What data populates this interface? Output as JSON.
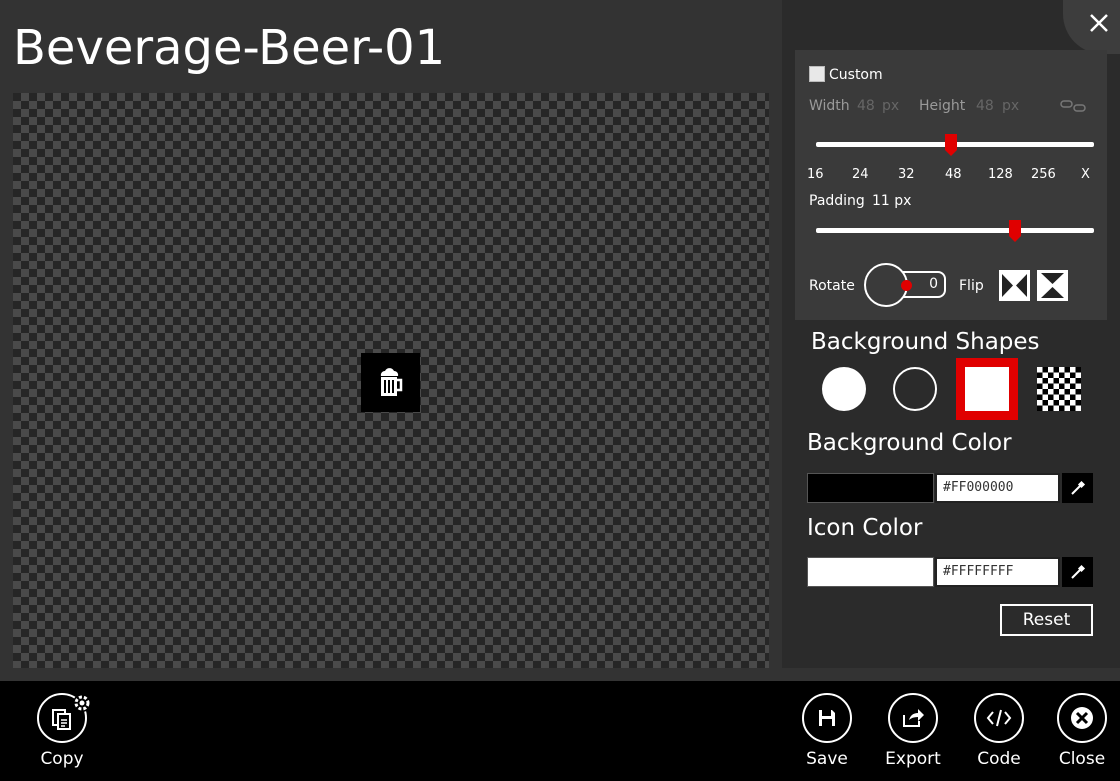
{
  "title": "Beverage-Beer-01",
  "size": {
    "custom_label": "Custom",
    "width_label": "Width",
    "width_value": "48",
    "height_label": "Height",
    "height_value": "48",
    "unit": "px",
    "ticks": [
      "16",
      "24",
      "32",
      "48",
      "128",
      "256",
      "X"
    ],
    "selected_tick": "48"
  },
  "padding": {
    "label": "Padding",
    "value": "11 px",
    "slider_fraction": 0.7
  },
  "rotate": {
    "label": "Rotate",
    "value": "0"
  },
  "flip": {
    "label": "Flip"
  },
  "background_shapes": {
    "heading": "Background Shapes",
    "options": [
      "circle-filled",
      "circle-outline",
      "square",
      "transparent"
    ],
    "selected": "square"
  },
  "background_color": {
    "heading": "Background Color",
    "hex": "#FF000000",
    "swatch": "#000000"
  },
  "icon_color": {
    "heading": "Icon Color",
    "hex": "#FFFFFFFF",
    "swatch": "#FFFFFF"
  },
  "reset_label": "Reset",
  "bottom_bar": {
    "copy": "Copy",
    "save": "Save",
    "export": "Export",
    "code": "Code",
    "close": "Close"
  },
  "accent_color": "#E00000"
}
